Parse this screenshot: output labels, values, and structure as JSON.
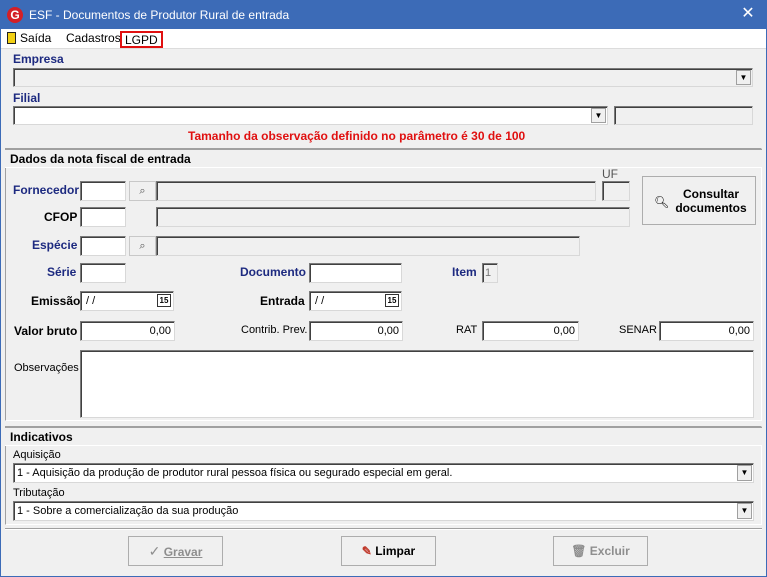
{
  "window": {
    "title": "ESF - Documentos de Produtor Rural de entrada",
    "app_icon": "G"
  },
  "menu": {
    "saida": "Saída",
    "cadastros": "Cadastros",
    "lgpd": "LGPD"
  },
  "empresa": {
    "label": "Empresa",
    "value": ""
  },
  "filial": {
    "label": "Filial",
    "value": ""
  },
  "warning": "Tamanho da observação definido no parâmetro é 30 de 100",
  "nota_section": "Dados da nota fiscal de entrada",
  "fields": {
    "fornecedor": "Fornecedor",
    "uf": "UF",
    "cfop": "CFOP",
    "especie": "Espécie",
    "serie": "Série",
    "documento": "Documento",
    "item": "Item",
    "item_value": "1",
    "emissao": "Emissão",
    "emissao_value": " / /",
    "entrada": "Entrada",
    "entrada_value": " / /",
    "valor_bruto": "Valor bruto",
    "valor_bruto_value": "0,00",
    "contrib_prev": "Contrib. Prev.",
    "contrib_prev_value": "0,00",
    "rat": "RAT",
    "rat_value": "0,00",
    "senar": "SENAR",
    "senar_value": "0,00",
    "observacoes": "Observações"
  },
  "consultar_button": {
    "line1": "Consultar",
    "line2": "documentos"
  },
  "indicativos": {
    "section": "Indicativos",
    "aquisicao_label": "Aquisição",
    "aquisicao_value": "1 - Aquisição da produção de produtor rural pessoa física ou segurado especial em geral.",
    "tributacao_label": "Tributação",
    "tributacao_value": "1 - Sobre a comercialização da sua produção"
  },
  "buttons": {
    "gravar": "Gravar",
    "limpar": "Limpar",
    "excluir": "Excluir"
  },
  "colors": {
    "titlebar": "#3c6bb7",
    "label_blue": "#1d2a80",
    "warning_red": "#e01010"
  }
}
